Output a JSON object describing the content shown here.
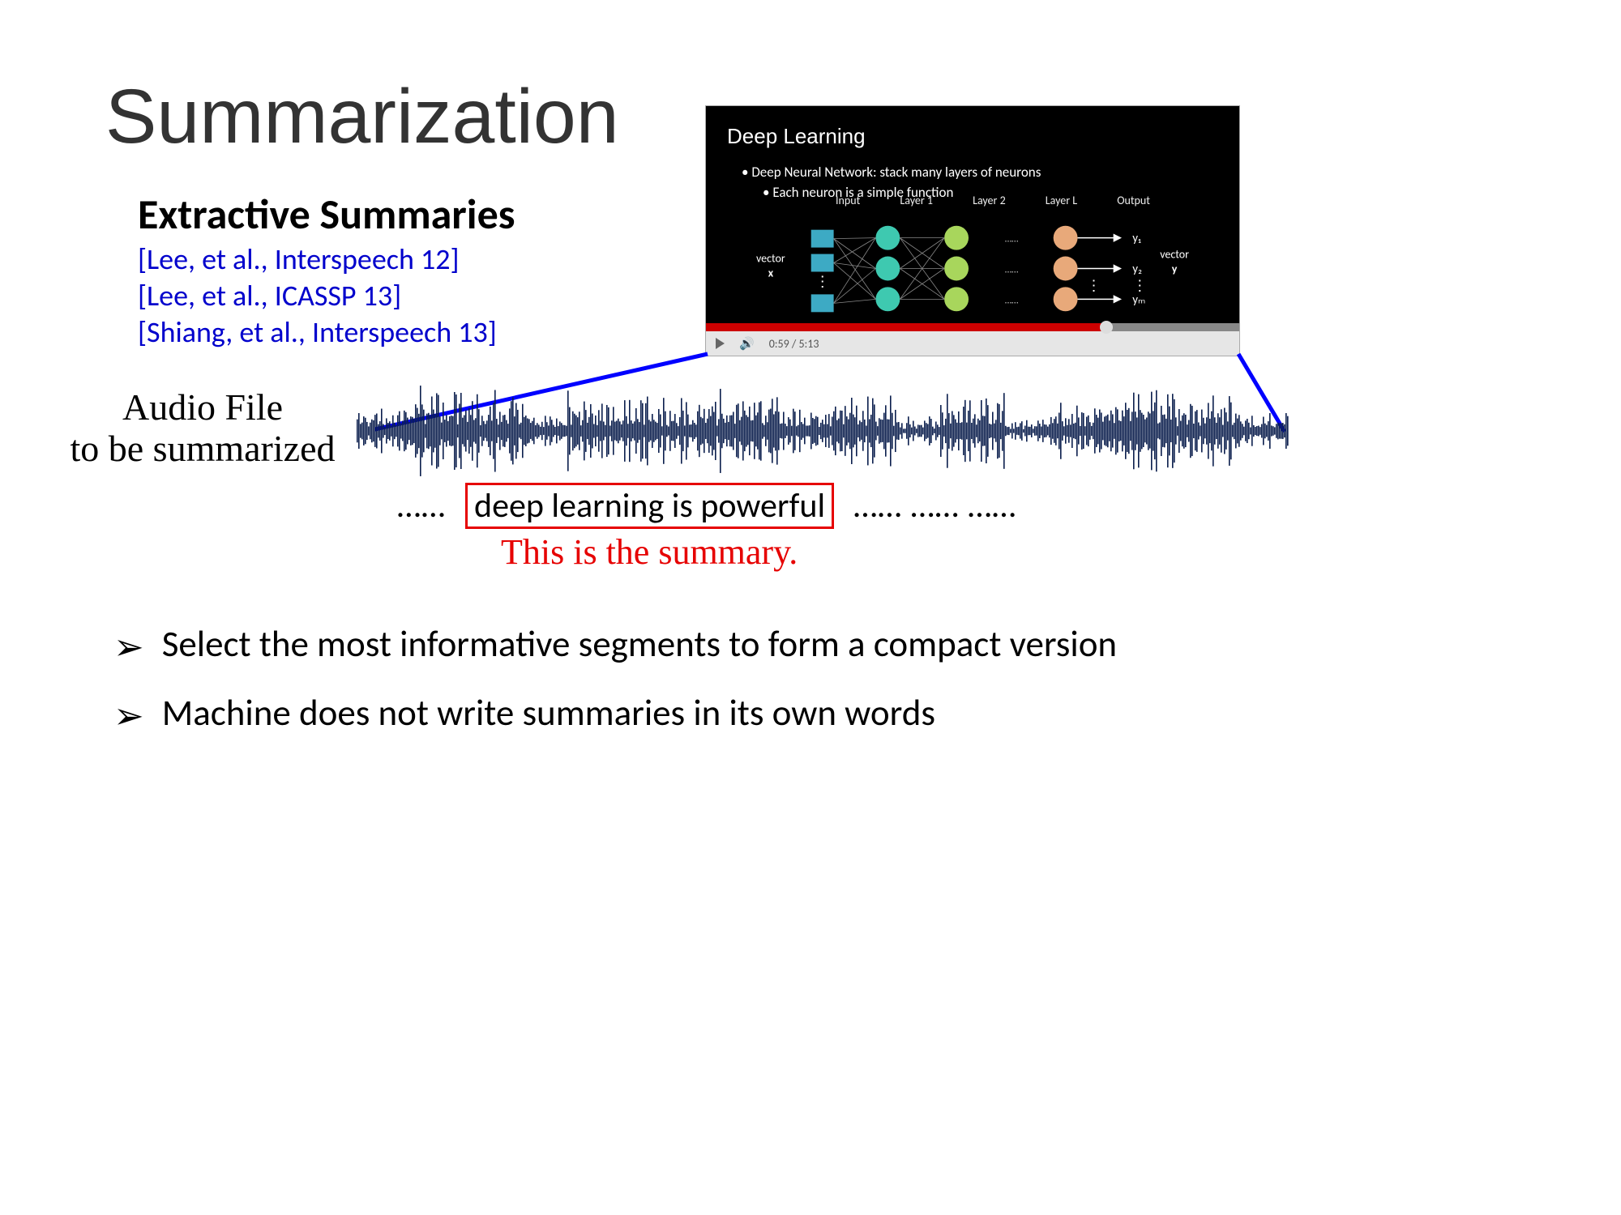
{
  "title": "Summarization",
  "subtitle": "Extractive Summaries",
  "citations": [
    "[Lee, et al., Interspeech 12]",
    "[Lee, et al., ICASSP 13]",
    "[Shiang, et al., Interspeech 13]"
  ],
  "video": {
    "title": "Deep Learning",
    "bullet": "Deep Neural Network: stack many layers of neurons",
    "subbullet": "Each neuron is a simple function",
    "layer_labels": [
      "Input",
      "Layer 1",
      "Layer 2",
      "Layer L",
      "Output"
    ],
    "left_label": "vector\nx",
    "right_label": "vector\ny",
    "outputs": [
      "y₁",
      "y₂",
      "yₘ"
    ],
    "time": "0:59 / 5:13"
  },
  "audio_label_line1": "Audio File",
  "audio_label_line2": "to be summarized",
  "transcript": {
    "pre": "……",
    "highlight": "deep learning is powerful",
    "post": "……   ……   ……"
  },
  "summary_caption": "This is the summary.",
  "bullets": [
    "Select the most informative segments to form a compact version",
    "Machine does not write summaries in its own words"
  ]
}
